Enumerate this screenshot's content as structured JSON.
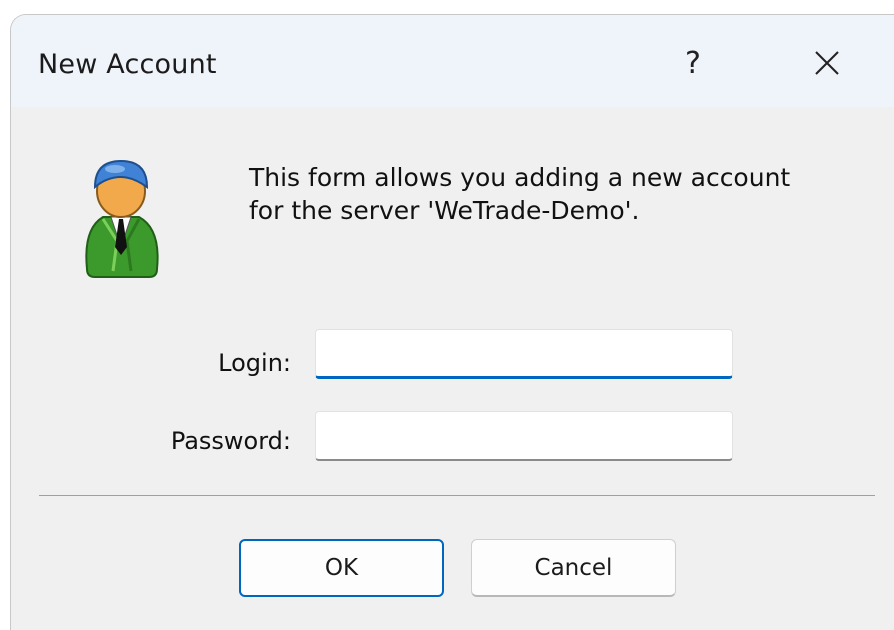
{
  "window": {
    "title": "New Account",
    "help_label": "?"
  },
  "info": {
    "line1": "This form allows you adding a new account",
    "line2": "for the server 'WeTrade-Demo'."
  },
  "form": {
    "login_label": "Login:",
    "login_value": "",
    "password_label": "Password:",
    "password_value": ""
  },
  "buttons": {
    "ok_label": "OK",
    "cancel_label": "Cancel"
  },
  "icons": {
    "avatar": "user-account-icon",
    "close": "close-icon",
    "help": "help-icon"
  },
  "colors": {
    "accent": "#0067c0",
    "titlebar": "#eff3fa",
    "dialog_bg": "#f0f0f0"
  }
}
